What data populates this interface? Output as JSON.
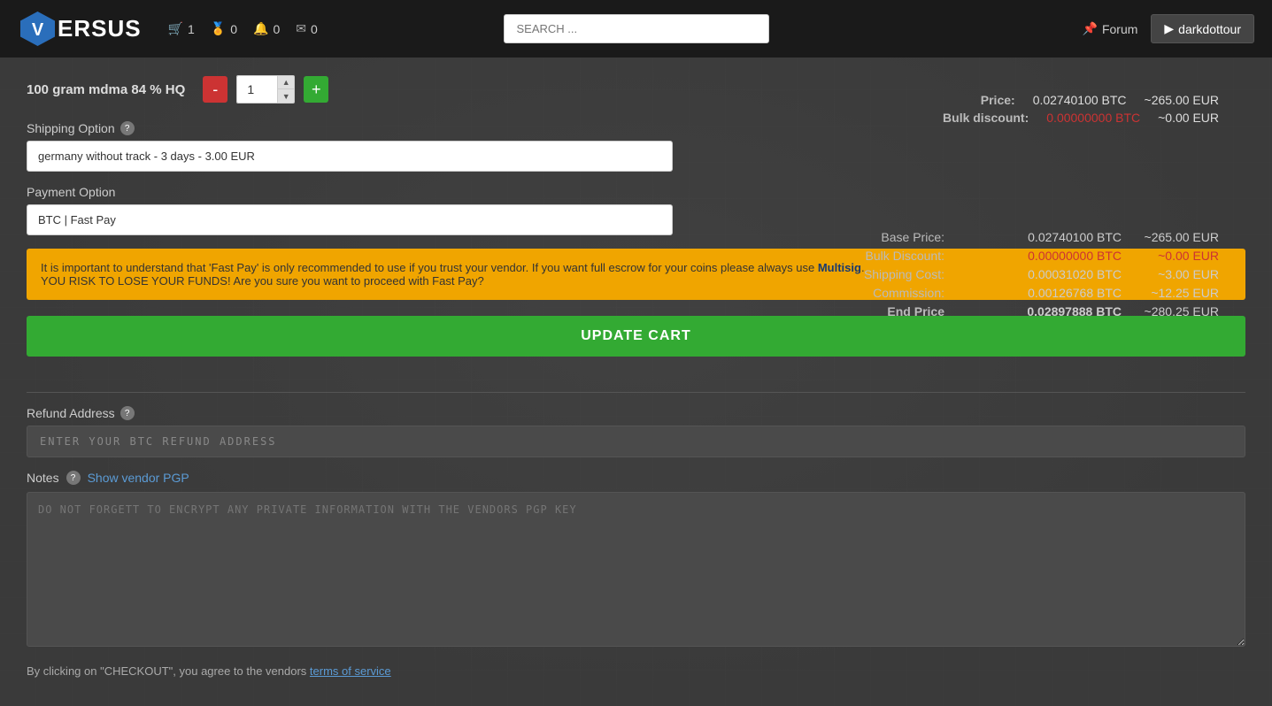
{
  "header": {
    "logo_text": "ERSUS",
    "cart_count": "1",
    "coins_count": "0",
    "notif_count": "0",
    "mail_count": "0",
    "search_placeholder": "SEARCH ...",
    "forum_label": "Forum",
    "user_label": "darkdottour"
  },
  "cart": {
    "item_title": "100 gram mdma 84 % HQ",
    "quantity": "1",
    "price_label": "Price:",
    "price_btc": "0.02740100 BTC",
    "price_eur": "~265.00 EUR",
    "bulk_discount_label": "Bulk discount:",
    "bulk_discount_btc": "0.00000000 BTC",
    "bulk_discount_eur": "~0.00 EUR"
  },
  "price_details": {
    "base_price_label": "Base Price:",
    "base_price_btc": "0.02740100 BTC",
    "base_price_eur": "~265.00 EUR",
    "bulk_discount_label": "Bulk Discount:",
    "bulk_discount_btc": "0.00000000 BTC",
    "bulk_discount_eur": "~0.00 EUR",
    "shipping_cost_label": "Shipping Cost:",
    "shipping_cost_btc": "0.00031020 BTC",
    "shipping_cost_eur": "~3.00 EUR",
    "commission_label": "Commission:",
    "commission_btc": "0.00126768 BTC",
    "commission_eur": "~12.25 EUR",
    "end_price_label": "End Price",
    "end_price_btc": "0.02897888 BTC",
    "end_price_eur": "~280.25 EUR"
  },
  "shipping": {
    "label": "Shipping Option",
    "selected": "germany without track - 3 days - 3.00 EUR"
  },
  "payment": {
    "label": "Payment Option",
    "selected": "BTC | Fast Pay"
  },
  "warning": {
    "text1": "It is important to understand that 'Fast Pay' is only recommended to use if you trust your vendor. If you want full escrow for your coins please always use ",
    "link_text": "Multisig",
    "text2": ".",
    "text3": "YOU RISK TO LOSE YOUR FUNDS! Are you sure you want to proceed with Fast Pay?"
  },
  "update_cart_btn": "UPDATE CART",
  "refund": {
    "label": "Refund Address",
    "placeholder": "ENTER YOUR BTC REFUND ADDRESS"
  },
  "notes": {
    "label": "Notes",
    "show_pgp_label": "Show vendor PGP",
    "placeholder": "DO NOT FORGETT TO ENCRYPT ANY PRIVATE INFORMATION WITH THE VENDORS PGP KEY"
  },
  "footer": {
    "text": "By clicking on \"CHECKOUT\", you agree to the vendors ",
    "link_text": "terms of service"
  },
  "icons": {
    "cart": "🛒",
    "coins": "🏅",
    "bell": "🔔",
    "mail": "✉",
    "forum_pin": "📌",
    "chevron": "▶",
    "question": "?"
  }
}
